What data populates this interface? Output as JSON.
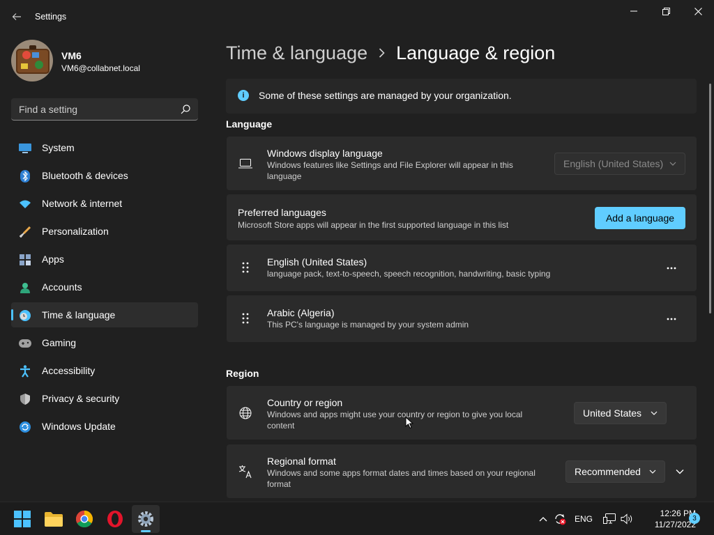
{
  "window": {
    "title": "Settings"
  },
  "user": {
    "name": "VM6",
    "email": "VM6@collabnet.local"
  },
  "search": {
    "placeholder": "Find a setting"
  },
  "sidebar": {
    "items": [
      {
        "label": "System",
        "icon": "system-icon"
      },
      {
        "label": "Bluetooth & devices",
        "icon": "bluetooth-icon"
      },
      {
        "label": "Network & internet",
        "icon": "wifi-icon"
      },
      {
        "label": "Personalization",
        "icon": "brush-icon"
      },
      {
        "label": "Apps",
        "icon": "apps-icon"
      },
      {
        "label": "Accounts",
        "icon": "person-icon"
      },
      {
        "label": "Time & language",
        "icon": "clock-globe-icon",
        "active": true
      },
      {
        "label": "Gaming",
        "icon": "gamepad-icon"
      },
      {
        "label": "Accessibility",
        "icon": "accessibility-icon"
      },
      {
        "label": "Privacy & security",
        "icon": "shield-icon"
      },
      {
        "label": "Windows Update",
        "icon": "update-icon"
      }
    ]
  },
  "breadcrumb": {
    "parent": "Time & language",
    "current": "Language & region"
  },
  "info": {
    "text": "Some of these settings are managed by your organization."
  },
  "language_section": {
    "label": "Language",
    "display_language": {
      "title": "Windows display language",
      "description": "Windows features like Settings and File Explorer will appear in this language",
      "value": "English (United States)"
    },
    "preferred": {
      "title": "Preferred languages",
      "description": "Microsoft Store apps will appear in the first supported language in this list",
      "button": "Add a language"
    },
    "languages": [
      {
        "name": "English (United States)",
        "details": "language pack, text-to-speech, speech recognition, handwriting, basic typing"
      },
      {
        "name": "Arabic (Algeria)",
        "details": "This PC's language is managed by your system admin"
      }
    ]
  },
  "region_section": {
    "label": "Region",
    "country": {
      "title": "Country or region",
      "description": "Windows and apps might use your country or region to give you local content",
      "value": "United States"
    },
    "format": {
      "title": "Regional format",
      "description": "Windows and some apps format dates and times based on your regional format",
      "value": "Recommended"
    }
  },
  "taskbar": {
    "apps": [
      "start-icon",
      "file-explorer-icon",
      "chrome-icon",
      "opera-icon",
      "settings-icon"
    ],
    "language": "ENG",
    "time": "12:26 PM",
    "date": "11/27/2022",
    "notifications": "3"
  },
  "colors": {
    "accent": "#60cdff",
    "background": "#202020",
    "card": "#2b2b2b"
  }
}
